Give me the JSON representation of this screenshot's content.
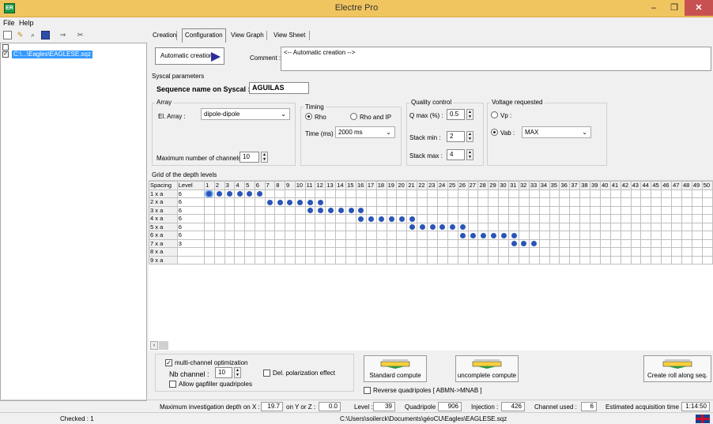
{
  "window": {
    "title": "Electre Pro",
    "min": "–",
    "max": "❐",
    "close": "✕",
    "app_icon": "ER"
  },
  "menu": {
    "file": "File",
    "help": "Help"
  },
  "tree": {
    "item": "C:\\...\\Eagles\\EAGLESE.sqz"
  },
  "tabs": [
    "Creation",
    "Configuration",
    "View Graph",
    "View Sheet"
  ],
  "creation": {
    "auto_button": "Automatic creation",
    "comment_label": "Comment :",
    "comment_value": "<-- Automatic creation -->"
  },
  "syscal": {
    "group_title": "Syscal parameters",
    "seq_label": "Sequence name on Syscal :",
    "seq_value": "AGUILAS",
    "array": {
      "title": "Array",
      "label": "El. Array :",
      "value": "dipole-dipole",
      "max_channels_label": "Maximum number of channels :",
      "max_channels": "10"
    },
    "timing": {
      "title": "Timing",
      "rho": "Rho",
      "rho_ip": "Rho and  IP",
      "time_label": "Time (ms) :",
      "time_value": "2000 ms"
    },
    "quality": {
      "title": "Quality control",
      "qmax_label": "Q max (%) :",
      "qmax": "0.5",
      "stack_min_label": "Stack min :",
      "stack_min": "2",
      "stack_max_label": "Stack max :",
      "stack_max": "4"
    },
    "voltage": {
      "title": "Voltage requested",
      "vp": "Vp :",
      "vab": "Vab :",
      "vab_value": "MAX"
    }
  },
  "grid": {
    "title": "Grid of the depth levels",
    "col_spacing": "Spacing",
    "col_level": "Level",
    "numbers": [
      "1",
      "2",
      "3",
      "4",
      "5",
      "6",
      "7",
      "8",
      "9",
      "10",
      "11",
      "12",
      "13",
      "14",
      "15",
      "16",
      "17",
      "18",
      "19",
      "20",
      "21",
      "22",
      "23",
      "24",
      "25",
      "26",
      "27",
      "28",
      "29",
      "30",
      "31",
      "32",
      "33",
      "34",
      "35",
      "36",
      "37",
      "38",
      "39",
      "40",
      "41",
      "42",
      "43",
      "44",
      "45",
      "46",
      "47",
      "48",
      "49",
      "50"
    ],
    "rows": [
      {
        "spacing": "1 x a",
        "level": "6",
        "start": 1,
        "count": 6
      },
      {
        "spacing": "2 x a",
        "level": "6",
        "start": 7,
        "count": 6
      },
      {
        "spacing": "3 x a",
        "level": "6",
        "start": 11,
        "count": 6
      },
      {
        "spacing": "4 x a",
        "level": "6",
        "start": 16,
        "count": 6
      },
      {
        "spacing": "5 x a",
        "level": "6",
        "start": 21,
        "count": 6
      },
      {
        "spacing": "6 x a",
        "level": "6",
        "start": 26,
        "count": 6
      },
      {
        "spacing": "7 x a",
        "level": "3",
        "start": 31,
        "count": 3
      },
      {
        "spacing": "8 x a",
        "level": "",
        "start": 0,
        "count": 0
      },
      {
        "spacing": "9 x a",
        "level": "",
        "start": 0,
        "count": 0
      }
    ]
  },
  "options": {
    "multi_channel": "multi-channel optimization",
    "nb_channel_label": "Nb channel :",
    "nb_channel": "10",
    "del_polarization": "Del. polarization effect",
    "allow_gapfiller": "Allow gapfiller quadripoles",
    "standard_compute": "Standard compute",
    "uncomplete_compute": "uncomplete compute",
    "reverse_quad": "Reverse quadripoles  [ ABMN->MNAB ]",
    "create_roll": "Create roll along seq."
  },
  "status": {
    "max_depth_x_label": "Maximum investigation depth on X :",
    "max_depth_x": "19.7",
    "on_yz_label": "on Y or Z :",
    "on_yz": "0.0",
    "level_label": "Level :",
    "level": "39",
    "quadripole_label": "Quadripole :",
    "quadripole": "906",
    "injection_label": "Injection :",
    "injection": "426",
    "channel_used_label": "Channel used :",
    "channel_used": "6",
    "est_time_label": "Estimated acquisition time :",
    "est_time": "1:14:50",
    "checked": "Checked : 1",
    "path": "C:\\Users\\soilerck\\Documents\\géoCU\\Eagles\\EAGLESE.sqz"
  }
}
